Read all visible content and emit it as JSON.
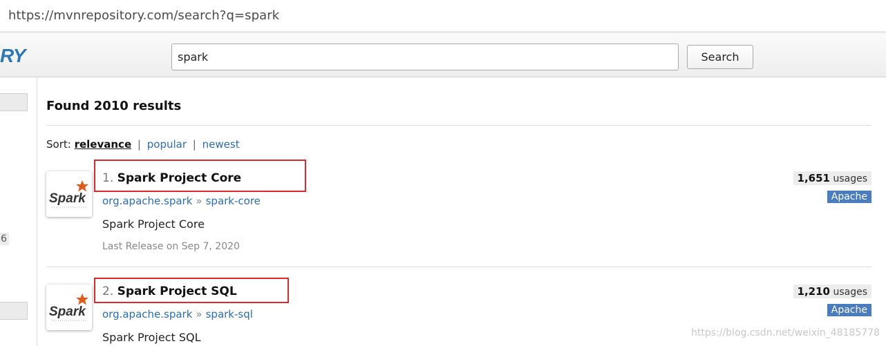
{
  "browser": {
    "url": "https://mvnrepository.com/search?q=spark"
  },
  "header": {
    "logo_fragment": "RY",
    "search_value": "spark",
    "search_button": "Search"
  },
  "sidebar": {
    "visible_count_fragment": "6"
  },
  "main": {
    "found_text": "Found 2010 results",
    "sort_label": "Sort:",
    "sort_options": [
      "relevance",
      "popular",
      "newest"
    ],
    "sort_separators": [
      "|",
      "|"
    ],
    "results": [
      {
        "index": "1.",
        "title": "Spark Project Core",
        "group": "org.apache.spark",
        "arrow": "»",
        "artifact": "spark-core",
        "description": "Spark Project Core",
        "release": "Last Release on Sep 7, 2020",
        "usages_count": "1,651",
        "usages_label": "usages",
        "license": "Apache",
        "logo_text": "Spark"
      },
      {
        "index": "2.",
        "title": "Spark Project SQL",
        "group": "org.apache.spark",
        "arrow": "»",
        "artifact": "spark-sql",
        "description": "Spark Project SQL",
        "usages_count": "1,210",
        "usages_label": "usages",
        "license": "Apache",
        "logo_text": "Spark"
      }
    ]
  },
  "watermark": "https://blog.csdn.net/weixin_48185778",
  "colors": {
    "link": "#2a6db6",
    "license_badge": "#4a7cc0",
    "highlight_box": "#e0282b",
    "logo": "#2f78b8"
  }
}
